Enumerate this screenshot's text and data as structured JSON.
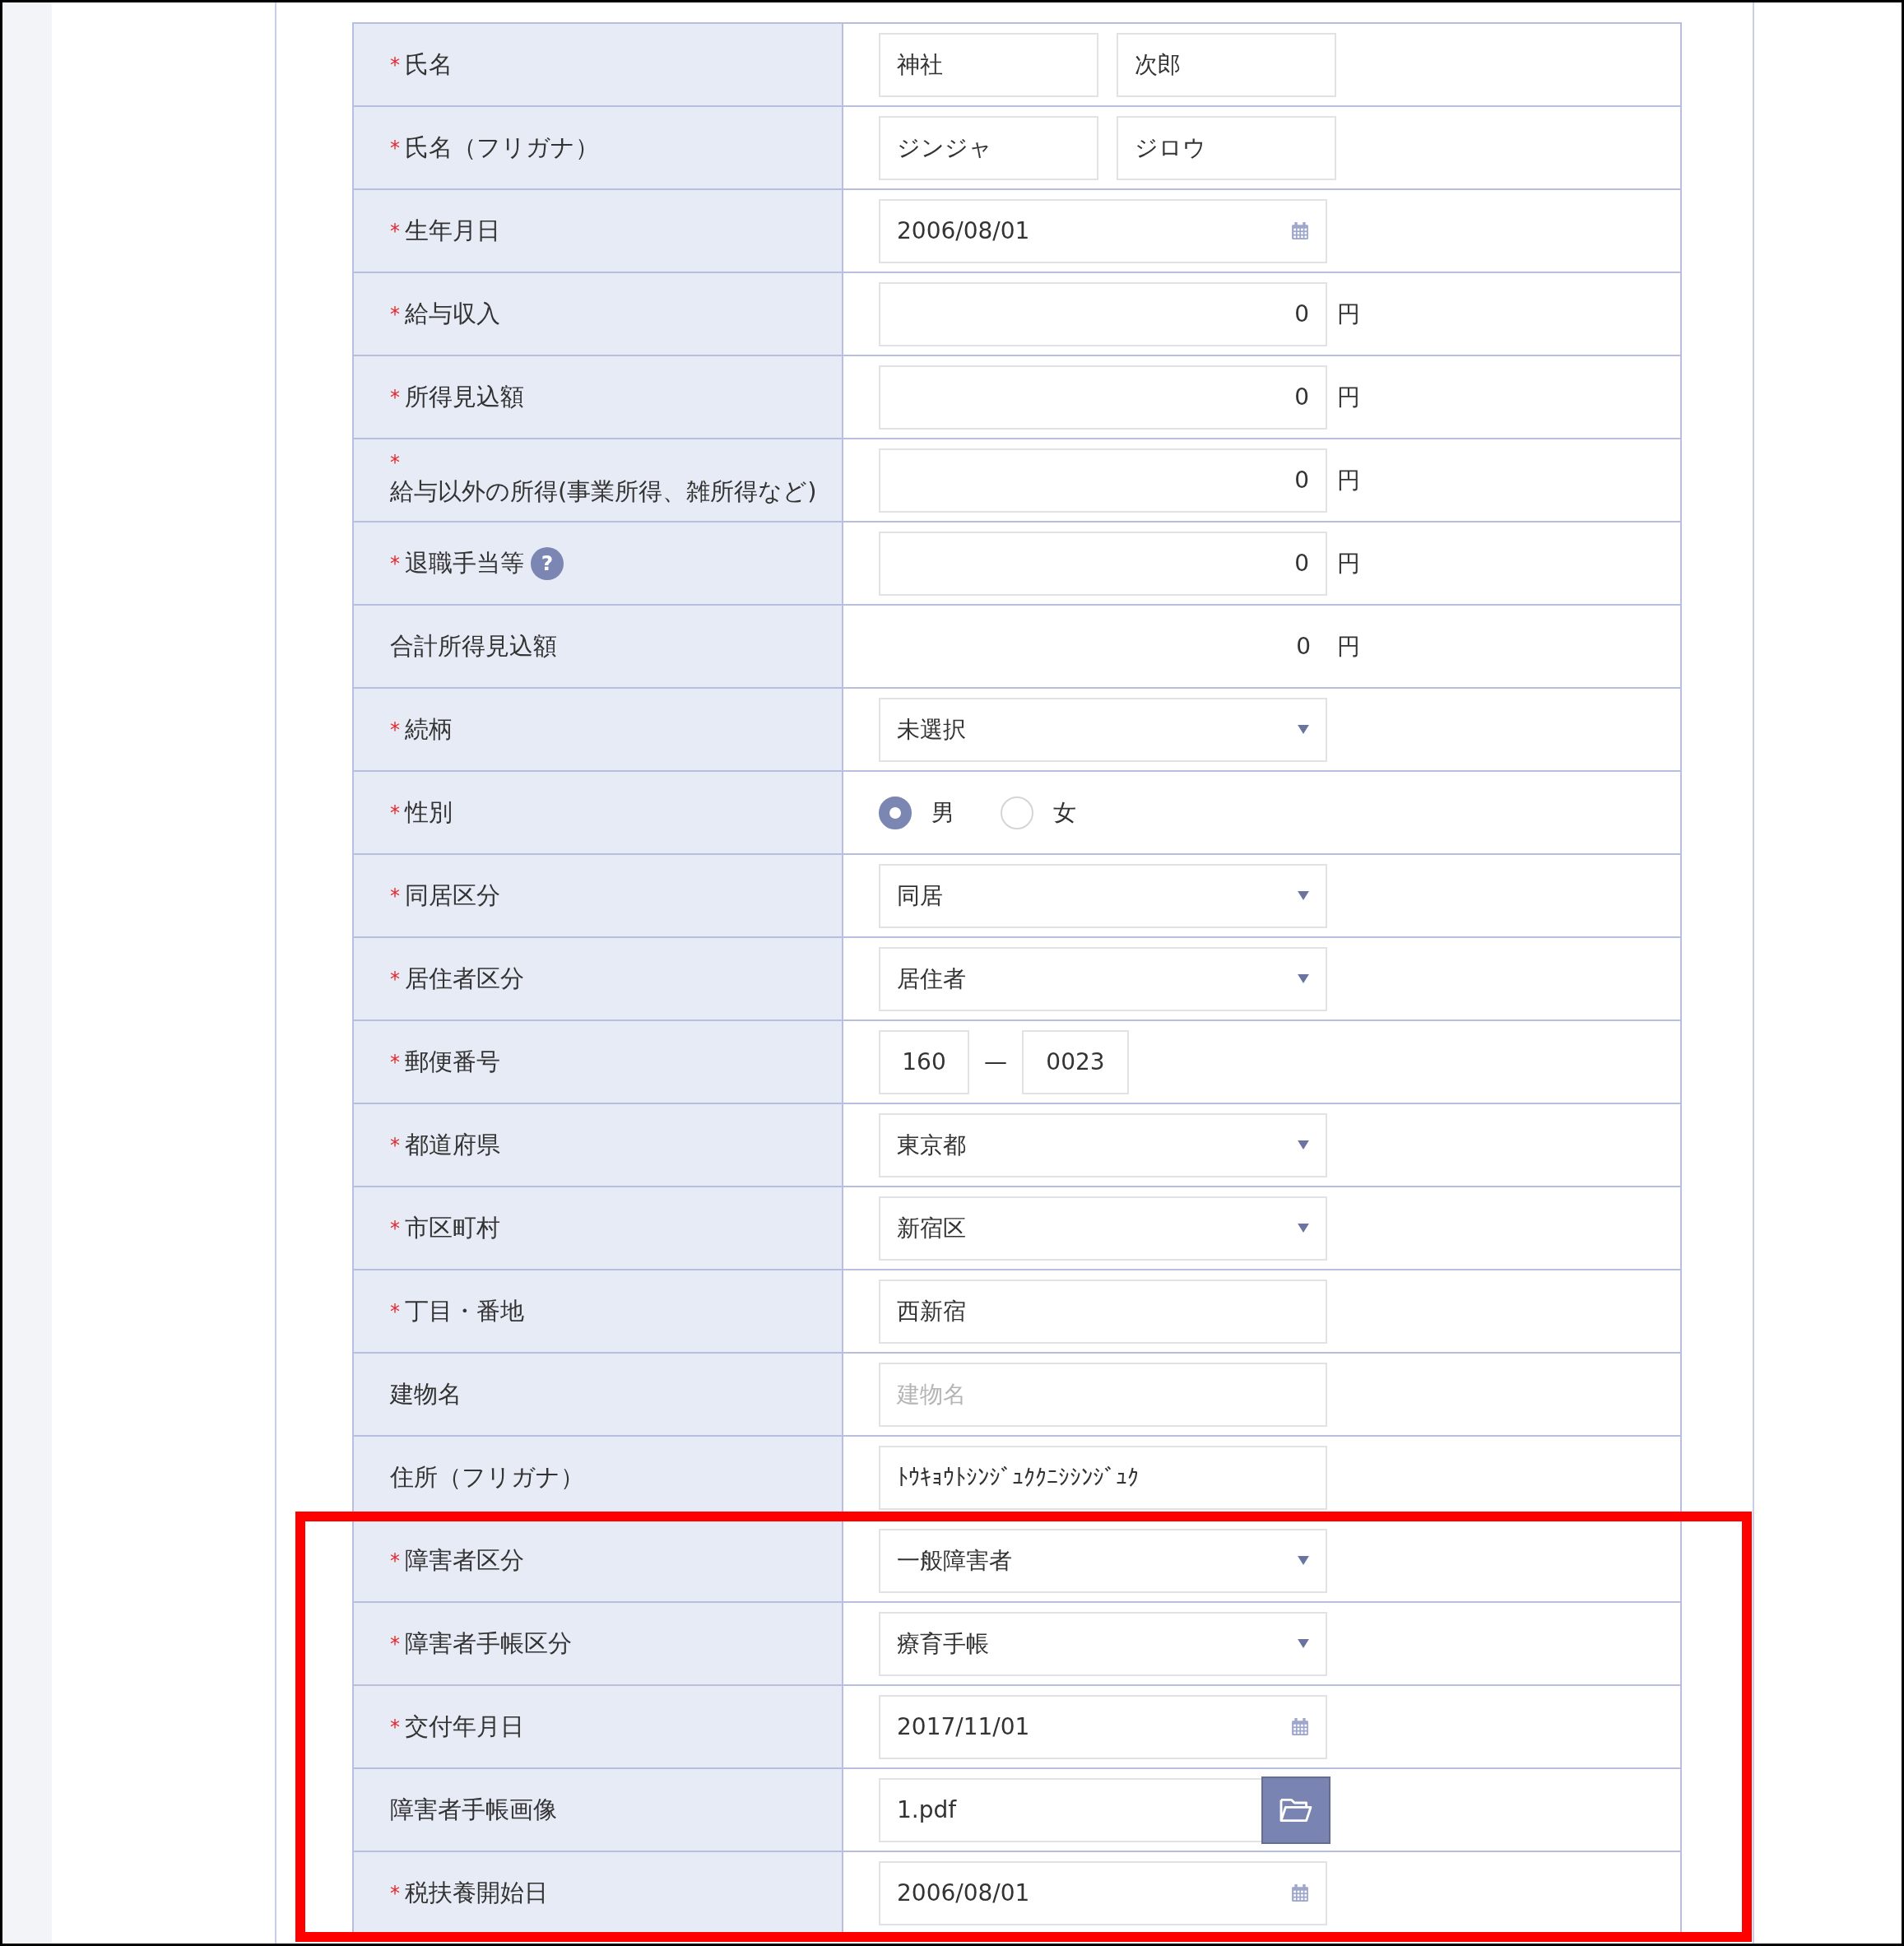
{
  "sections": [
    {
      "highlighted": false,
      "rows": [
        {
          "label": "氏名",
          "required_mark": "*",
          "kind": "name_pair",
          "values": [
            "神社",
            "次郎"
          ]
        },
        {
          "label": "氏名（フリガナ）",
          "required_mark": "*",
          "kind": "name_pair",
          "values": [
            "ジンジャ",
            "ジロウ"
          ]
        },
        {
          "label": "生年月日",
          "required_mark": "*",
          "kind": "date",
          "value": "2006/08/01"
        },
        {
          "label": "給与収入",
          "required_mark": "*",
          "kind": "amount",
          "value": "0",
          "unit": "円"
        },
        {
          "label": "所得見込額",
          "required_mark": "*",
          "kind": "amount",
          "value": "0",
          "unit": "円"
        },
        {
          "label": "給与以外の所得(事業所得、雑所得など)",
          "required_mark": "*",
          "kind": "amount",
          "value": "0",
          "unit": "円"
        },
        {
          "label": "退職手当等",
          "required_mark": "*",
          "help_icon": "?",
          "kind": "amount",
          "value": "0",
          "unit": "円"
        },
        {
          "label": "合計所得見込額",
          "kind": "total",
          "value": "0",
          "unit": "円"
        },
        {
          "label": "続柄",
          "required_mark": "*",
          "kind": "select",
          "value": "未選択"
        },
        {
          "label": "性別",
          "required_mark": "*",
          "kind": "radio",
          "options": [
            {
              "label": "男",
              "selected": true
            },
            {
              "label": "女",
              "selected": false
            }
          ]
        },
        {
          "label": "同居区分",
          "required_mark": "*",
          "kind": "select",
          "value": "同居"
        },
        {
          "label": "居住者区分",
          "required_mark": "*",
          "kind": "select",
          "value": "居住者"
        },
        {
          "label": "郵便番号",
          "required_mark": "*",
          "kind": "postal",
          "values": [
            "160",
            "0023"
          ],
          "separator": "—"
        },
        {
          "label": "都道府県",
          "required_mark": "*",
          "kind": "select",
          "value": "東京都"
        },
        {
          "label": "市区町村",
          "required_mark": "*",
          "kind": "select",
          "value": "新宿区"
        },
        {
          "label": "丁目・番地",
          "required_mark": "*",
          "kind": "text",
          "value": "西新宿"
        },
        {
          "label": "建物名",
          "kind": "text",
          "placeholder": "建物名"
        },
        {
          "label": "住所（フリガナ）",
          "kind": "text",
          "value": "ﾄｳｷｮｳﾄｼﾝｼﾞｭｸｸﾆｼｼﾝｼﾞｭｸ"
        }
      ]
    },
    {
      "highlighted": true,
      "rows": [
        {
          "label": "障害者区分",
          "required_mark": "*",
          "kind": "select",
          "value": "一般障害者"
        },
        {
          "label": "障害者手帳区分",
          "required_mark": "*",
          "kind": "select",
          "value": "療育手帳"
        },
        {
          "label": "交付年月日",
          "required_mark": "*",
          "kind": "date",
          "value": "2017/11/01"
        },
        {
          "label": "障害者手帳画像",
          "kind": "file",
          "value": "1.pdf"
        },
        {
          "label": "税扶養開始日",
          "required_mark": "*",
          "kind": "date",
          "value": "2006/08/01"
        }
      ]
    }
  ]
}
